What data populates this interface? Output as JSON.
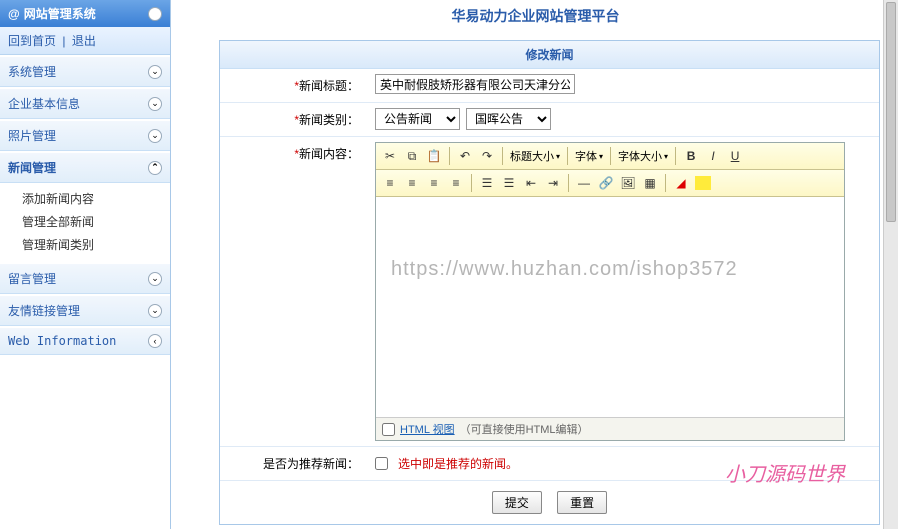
{
  "sidebar": {
    "title": "网站管理系统",
    "home": "回到首页",
    "logout": "退出",
    "sections": [
      {
        "label": "系统管理",
        "expanded": false
      },
      {
        "label": "企业基本信息",
        "expanded": false
      },
      {
        "label": "照片管理",
        "expanded": false
      },
      {
        "label": "新闻管理",
        "expanded": true,
        "items": [
          "添加新闻内容",
          "管理全部新闻",
          "管理新闻类别"
        ]
      },
      {
        "label": "留言管理",
        "expanded": false
      },
      {
        "label": "友情链接管理",
        "expanded": false
      },
      {
        "label": "Web Information",
        "expanded": false
      }
    ]
  },
  "main": {
    "platform_title": "华易动力企业网站管理平台",
    "panel_title": "修改新闻",
    "fields": {
      "title": {
        "label": "新闻标题：",
        "value": "英中耐假肢矫形器有限公司天津分公司"
      },
      "category": {
        "label": "新闻类别：",
        "cat1": "公告新闻",
        "cat2": "国晖公告"
      },
      "content": {
        "label": "新闻内容："
      },
      "recommend": {
        "label": "是否为推荐新闻：",
        "hint": "选中即是推荐的新闻。"
      }
    },
    "editor": {
      "toolbar": {
        "heading": "标题大小",
        "font": "字体",
        "size": "字体大小"
      },
      "footer": {
        "link": "HTML 视图",
        "hint": "（可直接使用HTML编辑）"
      }
    },
    "buttons": {
      "submit": "提交",
      "reset": "重置"
    }
  },
  "watermarks": {
    "url": "https://www.huzhan.com/ishop3572",
    "brand": "小刀源码世界"
  }
}
